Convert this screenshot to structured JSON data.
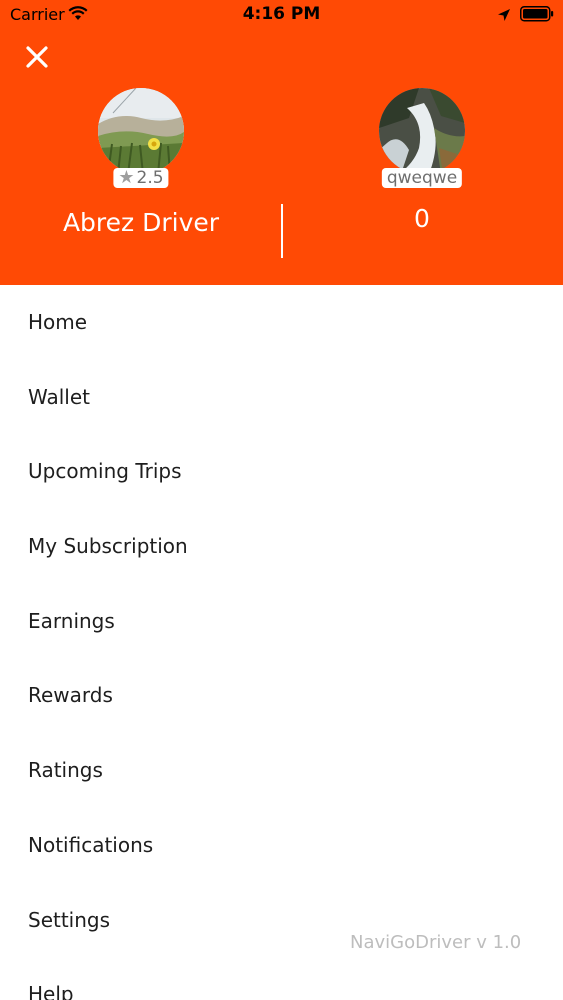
{
  "status_bar": {
    "carrier": "Carrier",
    "time": "4:16 PM",
    "icons": [
      "wifi-icon",
      "location-arrow-icon",
      "battery-icon"
    ]
  },
  "header": {
    "background_color": "#ff4a05",
    "close_icon": "close-icon",
    "driver": {
      "name": "Abrez Driver",
      "rating": "2.5",
      "rating_icon": "star-icon"
    },
    "vehicle": {
      "label": "qweqwe",
      "count": "0"
    }
  },
  "menu": {
    "items": [
      {
        "label": "Home"
      },
      {
        "label": "Wallet"
      },
      {
        "label": "Upcoming Trips"
      },
      {
        "label": "My Subscription"
      },
      {
        "label": "Earnings"
      },
      {
        "label": "Rewards"
      },
      {
        "label": "Ratings"
      },
      {
        "label": "Notifications"
      },
      {
        "label": "Settings"
      },
      {
        "label": "Help"
      }
    ]
  },
  "footer": {
    "version": "NaviGoDriver v 1.0"
  }
}
